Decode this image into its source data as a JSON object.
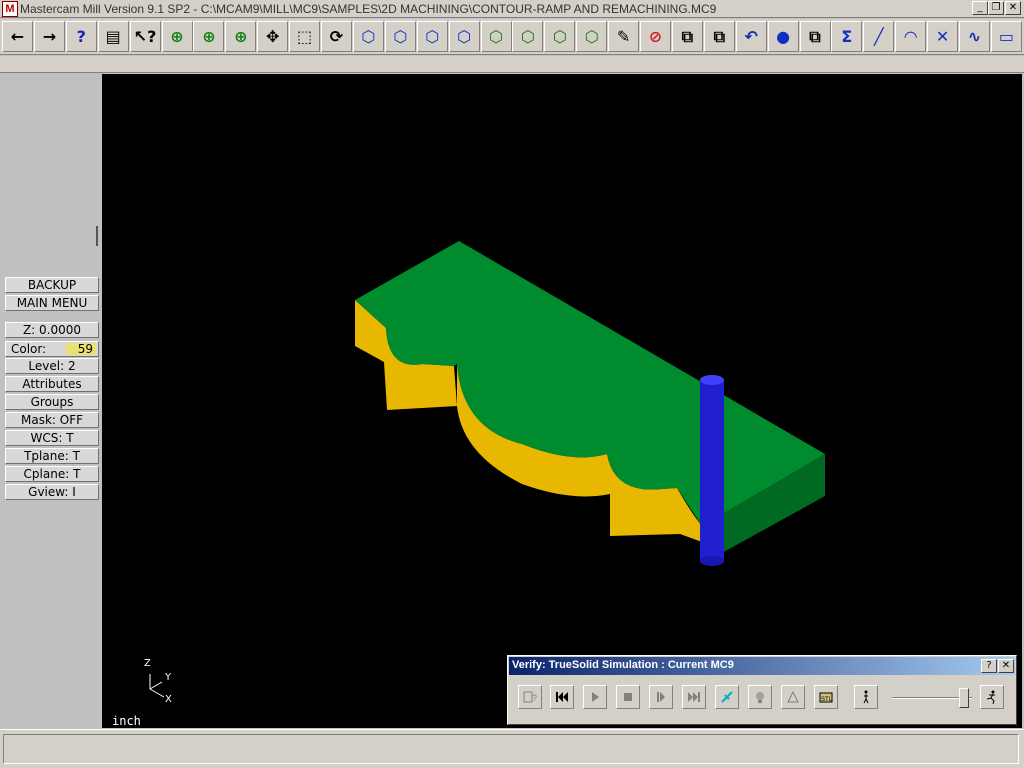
{
  "window": {
    "title": "Mastercam Mill Version 9.1 SP2 - C:\\MCAM9\\MILL\\MC9\\SAMPLES\\2D MACHINING\\CONTOUR-RAMP AND REMACHINING.MC9",
    "app_icon_letter": "M",
    "minimize_glyph": "_",
    "restore_glyph": "❐",
    "close_glyph": "✕"
  },
  "toolbar": {
    "buttons": [
      {
        "name": "back-arrow-icon",
        "glyph": "←"
      },
      {
        "name": "forward-arrow-icon",
        "glyph": "→"
      },
      {
        "name": "help-icon",
        "glyph": "?"
      },
      {
        "name": "file-manager-icon",
        "glyph": "▤"
      },
      {
        "name": "context-help-icon",
        "glyph": "↖?"
      },
      {
        "name": "zoom-window-icon",
        "glyph": "⊕"
      },
      {
        "name": "zoom-fit-icon",
        "glyph": "⊕"
      },
      {
        "name": "zoom-out-icon",
        "glyph": "⊕"
      },
      {
        "name": "pan-icon",
        "glyph": "✥"
      },
      {
        "name": "select-window-icon",
        "glyph": "⬚"
      },
      {
        "name": "dynamic-rotate-icon",
        "glyph": "⟳"
      },
      {
        "name": "isometric-view-icon",
        "glyph": "⬡"
      },
      {
        "name": "top-view-icon",
        "glyph": "⬡"
      },
      {
        "name": "front-view-icon",
        "glyph": "⬡"
      },
      {
        "name": "side-view-icon",
        "glyph": "⬡"
      },
      {
        "name": "cplane-iso-icon",
        "glyph": "⬡"
      },
      {
        "name": "cplane-top-icon",
        "glyph": "⬡"
      },
      {
        "name": "cplane-front-icon",
        "glyph": "⬡"
      },
      {
        "name": "cplane-side-icon",
        "glyph": "⬡"
      },
      {
        "name": "eraser-icon",
        "glyph": "✎"
      },
      {
        "name": "delete-icon",
        "glyph": "⊘"
      },
      {
        "name": "transform-translate-icon",
        "glyph": "⧉"
      },
      {
        "name": "transform-copy-icon",
        "glyph": "⧉"
      },
      {
        "name": "undo-icon",
        "glyph": "↶"
      },
      {
        "name": "shading-sphere-icon",
        "glyph": "●"
      },
      {
        "name": "transform-scale-icon",
        "glyph": "⧉"
      },
      {
        "name": "analyze-sum-icon",
        "glyph": "Σ"
      },
      {
        "name": "create-line-icon",
        "glyph": "╱"
      },
      {
        "name": "create-arc-icon",
        "glyph": "◠"
      },
      {
        "name": "trim-icon",
        "glyph": "✕"
      },
      {
        "name": "create-spline-icon",
        "glyph": "∿"
      },
      {
        "name": "create-rectangle-icon",
        "glyph": "▭"
      }
    ]
  },
  "left_menu": {
    "backup": "BACKUP",
    "main_menu": "MAIN MENU",
    "z_label": "Z:",
    "z_value": "0.0000",
    "color_label": "Color:",
    "color_value": "59",
    "level_label": "Level:",
    "level_value": "2",
    "attributes": "Attributes",
    "groups": "Groups",
    "mask_label": "Mask:",
    "mask_value": "OFF",
    "wcs_label": "WCS:",
    "wcs_value": "T",
    "tplane_label": "Tplane:",
    "tplane_value": "T",
    "cplane_label": "Cplane:",
    "cplane_value": "T",
    "gview_label": "Gview:",
    "gview_value": "I"
  },
  "viewport": {
    "unit": "inch",
    "axis_z": "Z",
    "axis_y": "Y",
    "axis_x": "X",
    "part_top_color": "#008c2e",
    "part_side_color": "#e8b800",
    "tool_color": "#2020d0"
  },
  "verify_dialog": {
    "title": "Verify: TrueSolid Simulation : Current MC9",
    "help_glyph": "?",
    "close_glyph": "✕",
    "speed_fraction": 0.9
  }
}
